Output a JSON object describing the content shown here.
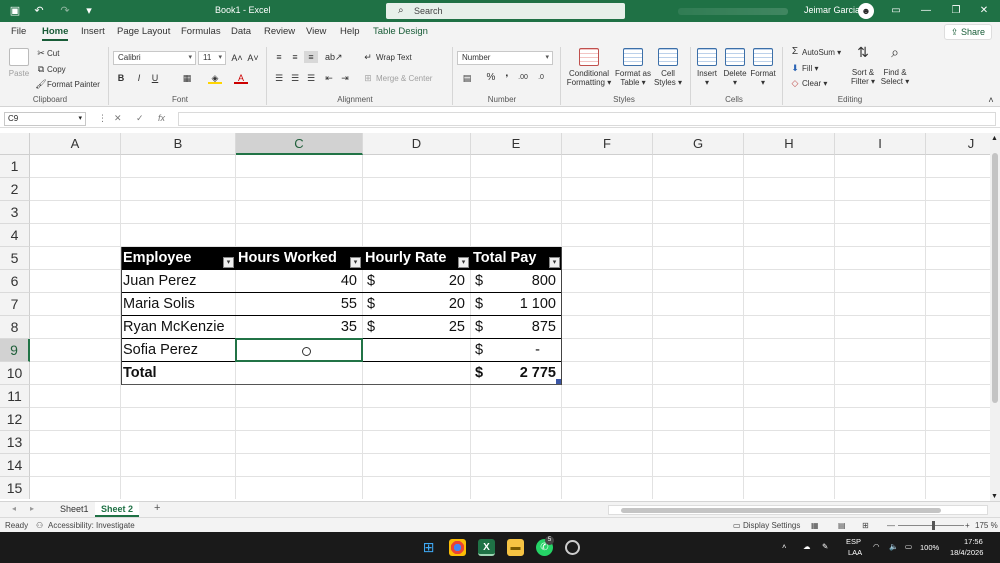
{
  "titlebar": {
    "doc_title": "Book1 - Excel",
    "search_placeholder": "Search",
    "user_name": "Jeimar Garcia"
  },
  "ribbon": {
    "tabs": [
      "File",
      "Home",
      "Insert",
      "Page Layout",
      "Formulas",
      "Data",
      "Review",
      "View",
      "Help",
      "Table Design"
    ],
    "active_tab": "Home",
    "share_label": "Share",
    "clipboard": {
      "paste": "Paste",
      "cut": "Cut",
      "copy": "Copy",
      "format_painter": "Format Painter",
      "label": "Clipboard"
    },
    "font": {
      "name": "Calibri",
      "size": "11",
      "bold": "B",
      "italic": "I",
      "underline": "U",
      "label": "Font"
    },
    "alignment": {
      "wrap_text": "Wrap Text",
      "merge_center": "Merge & Center",
      "label": "Alignment"
    },
    "number": {
      "format": "Number",
      "label": "Number"
    },
    "styles": {
      "conditional": "Conditional",
      "formatting": "Formatting",
      "format_as": "Format as",
      "table": "Table",
      "cell": "Cell",
      "styles_label": "Styles",
      "label": "Styles"
    },
    "cells": {
      "insert": "Insert",
      "delete": "Delete",
      "format": "Format",
      "label": "Cells"
    },
    "editing": {
      "autosum": "AutoSum",
      "fill": "Fill",
      "clear": "Clear",
      "sort": "Sort &",
      "filter": "Filter",
      "find": "Find &",
      "select": "Select",
      "label": "Editing"
    }
  },
  "formula_bar": {
    "name_box": "C9",
    "formula": ""
  },
  "grid": {
    "columns": [
      "A",
      "B",
      "C",
      "D",
      "E",
      "F",
      "G",
      "H",
      "I",
      "J"
    ],
    "selected_column": "C",
    "rows": [
      "1",
      "2",
      "3",
      "4",
      "5",
      "6",
      "7",
      "8",
      "9",
      "10",
      "11",
      "12",
      "13",
      "14",
      "15"
    ],
    "selected_row": "9"
  },
  "table": {
    "headers": [
      "Employee",
      "Hours Worked",
      "Hourly Rate",
      "Total Pay"
    ],
    "currency": "$",
    "rows": [
      {
        "employee": "Juan Perez",
        "hours": "40",
        "rate": "20",
        "pay": "800"
      },
      {
        "employee": "Maria Solis",
        "hours": "55",
        "rate": "20",
        "pay": "1 100"
      },
      {
        "employee": "Ryan McKenzie",
        "hours": "35",
        "rate": "25",
        "pay": "875"
      },
      {
        "employee": "Sofia Perez",
        "hours": "",
        "rate": "",
        "pay": "-"
      }
    ],
    "total": {
      "label": "Total",
      "pay": "2 775"
    }
  },
  "sheets": {
    "tabs": [
      "Sheet1",
      "Sheet 2"
    ],
    "active": "Sheet 2",
    "add": "+"
  },
  "status": {
    "ready": "Ready",
    "accessibility": "Accessibility: Investigate",
    "display_settings": "Display Settings",
    "zoom": "175 %"
  },
  "taskbar": {
    "lang_top": "ESP",
    "lang_bottom": "LAA",
    "battery": "100%",
    "time": "17:56",
    "date": "18/4/2026",
    "whatsapp_badge": "5"
  },
  "colors": {
    "excel_green": "#1f7145",
    "header_black": "#000000",
    "selection": "#217346"
  }
}
